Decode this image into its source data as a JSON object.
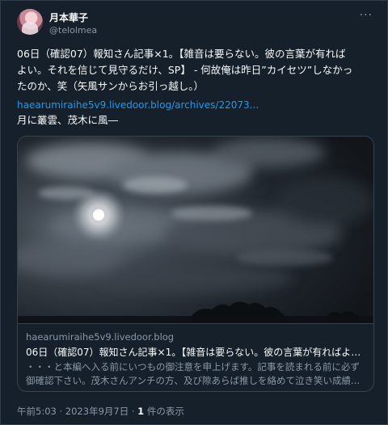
{
  "author": {
    "name": "月本華子",
    "handle": "@telolmea"
  },
  "menu_icon": "more-horizontal-icon",
  "tweet": {
    "lines": [
      "06日（確認07）報知さん記事×1。【雑音は要らない。彼の言葉が有れば",
      "よい。それを信じて見守るだけ、SP】 - 何故俺は昨日”カイセツ”しなかっ",
      "たのか、笑（矢風サンからお引っ越し。）"
    ],
    "link_text": "haearumiraihe5v9.livedoor.blog/archives/22073...",
    "tail": "月に叢雲、茂木に風―"
  },
  "card": {
    "domain": "haearumiraihe5v9.livedoor.blog",
    "title": "06日（確認07）報知さん記事×1。【雑音は要らない。彼の言葉が有ればよい...",
    "desc_lines": [
      "・・・と本編へ入る前にいつもの御注意を申上げます。記事を読まれる前に必ず",
      "御確認下さい。茂木さんアンチの方、及び隙あらば推しを絡めて泣き笑い成績..."
    ]
  },
  "footer": {
    "time": "午前5:03",
    "sep1": " · ",
    "date": "2023年9月7日",
    "sep2": " · ",
    "views_count": "1",
    "views_label": " 件の表示"
  }
}
